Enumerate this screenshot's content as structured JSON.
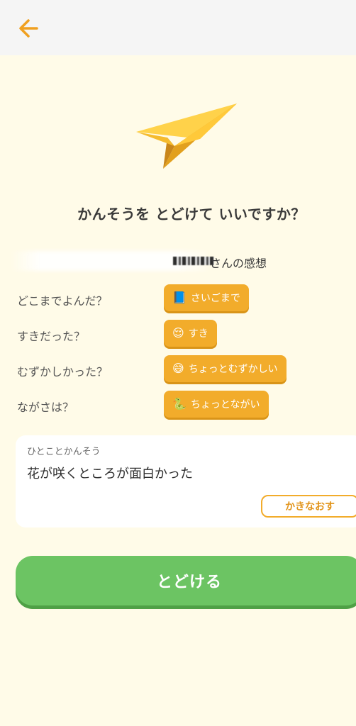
{
  "header": {
    "back_icon": "arrow-left-icon"
  },
  "hero": {
    "icon": "paper-plane-icon"
  },
  "question": "かんそうを とどけて いいですか？",
  "reviewer": {
    "name_suffix": "さんの感想"
  },
  "answers": [
    {
      "label": "どこまでよんだ？",
      "emoji": "📘",
      "value": "さいごまで"
    },
    {
      "label": "すきだった？",
      "emoji": "😌",
      "value": "すき"
    },
    {
      "label": "むずかしかった？",
      "emoji": "😅",
      "value": "ちょっとむずかしい"
    },
    {
      "label": "ながさは？",
      "emoji": "🐍",
      "value": "ちょっとながい"
    }
  ],
  "comment": {
    "heading": "ひとことかんそう",
    "text": "花が咲くところが面白かった",
    "rewrite_label": "かきなおす"
  },
  "send_label": "とどける",
  "colors": {
    "background": "#fffbe8",
    "accent_orange": "#f2ac2b",
    "send_green": "#6cc463",
    "back_arrow": "#f0a020"
  }
}
